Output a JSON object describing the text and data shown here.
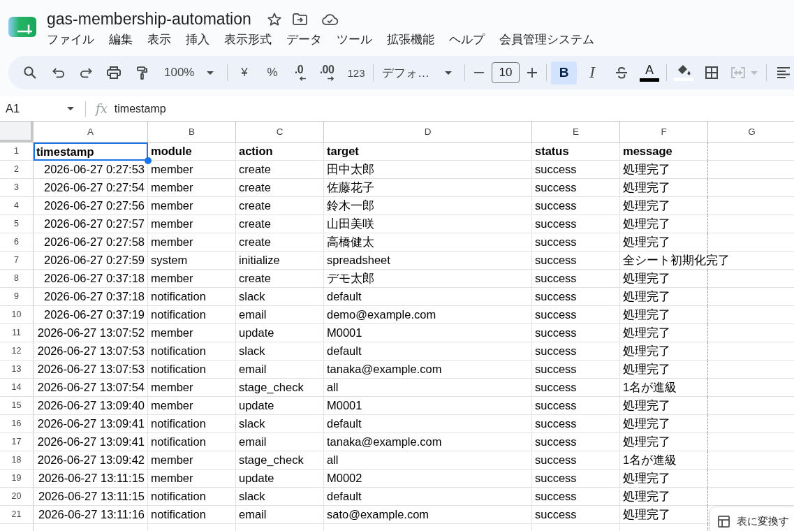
{
  "document": {
    "title": "gas-membership-automation"
  },
  "menu": [
    "ファイル",
    "編集",
    "表示",
    "挿入",
    "表示形式",
    "データ",
    "ツール",
    "拡張機能",
    "ヘルプ",
    "会員管理システム"
  ],
  "toolbar": {
    "zoom": "100%",
    "currency": "¥",
    "percent": "%",
    "decrease_decimals": ".0",
    "increase_decimals": ".00",
    "number_format": "123",
    "font": "デフォ…",
    "font_size": "10",
    "text_styles": [
      {
        "kind": "bold",
        "label": "B",
        "on": true
      },
      {
        "kind": "italic",
        "label": "I",
        "on": false
      },
      {
        "kind": "strikethrough",
        "on": false
      }
    ],
    "text_color": {
      "label": "A"
    },
    "merge": {
      "disabled": true
    }
  },
  "formula_bar": {
    "cell_reference": "A1",
    "function_label": "fx",
    "content": "timestamp"
  },
  "columns": [
    "A",
    "B",
    "C",
    "D",
    "E",
    "F",
    "G"
  ],
  "rows": [
    {
      "number": "1",
      "kind": "header",
      "cells": [
        {
          "text": "timestamp",
          "selected": true
        },
        {
          "text": "module",
          "selected": false
        },
        {
          "text": "action",
          "selected": false
        },
        {
          "text": "target",
          "selected": false
        },
        {
          "text": "status",
          "selected": false
        },
        {
          "text": "message",
          "selected": false
        }
      ]
    },
    {
      "number": "2",
      "kind": "data",
      "cells": [
        {
          "text": "2026-06-27 0:27:53",
          "selected": false
        },
        {
          "text": "member",
          "selected": false
        },
        {
          "text": "create",
          "selected": false
        },
        {
          "text": "田中太郎",
          "selected": false
        },
        {
          "text": "success",
          "selected": false
        },
        {
          "text": "処理完了",
          "selected": false
        }
      ]
    },
    {
      "number": "3",
      "kind": "data",
      "cells": [
        {
          "text": "2026-06-27 0:27:54",
          "selected": false
        },
        {
          "text": "member",
          "selected": false
        },
        {
          "text": "create",
          "selected": false
        },
        {
          "text": "佐藤花子",
          "selected": false
        },
        {
          "text": "success",
          "selected": false
        },
        {
          "text": "処理完了",
          "selected": false
        }
      ]
    },
    {
      "number": "4",
      "kind": "data",
      "cells": [
        {
          "text": "2026-06-27 0:27:56",
          "selected": false
        },
        {
          "text": "member",
          "selected": false
        },
        {
          "text": "create",
          "selected": false
        },
        {
          "text": "鈴木一郎",
          "selected": false
        },
        {
          "text": "success",
          "selected": false
        },
        {
          "text": "処理完了",
          "selected": false
        }
      ]
    },
    {
      "number": "5",
      "kind": "data",
      "cells": [
        {
          "text": "2026-06-27 0:27:57",
          "selected": false
        },
        {
          "text": "member",
          "selected": false
        },
        {
          "text": "create",
          "selected": false
        },
        {
          "text": "山田美咲",
          "selected": false
        },
        {
          "text": "success",
          "selected": false
        },
        {
          "text": "処理完了",
          "selected": false
        }
      ]
    },
    {
      "number": "6",
      "kind": "data",
      "cells": [
        {
          "text": "2026-06-27 0:27:58",
          "selected": false
        },
        {
          "text": "member",
          "selected": false
        },
        {
          "text": "create",
          "selected": false
        },
        {
          "text": "高橋健太",
          "selected": false
        },
        {
          "text": "success",
          "selected": false
        },
        {
          "text": "処理完了",
          "selected": false
        }
      ]
    },
    {
      "number": "7",
      "kind": "data",
      "cells": [
        {
          "text": "2026-06-27 0:27:59",
          "selected": false
        },
        {
          "text": "system",
          "selected": false
        },
        {
          "text": "initialize",
          "selected": false
        },
        {
          "text": "spreadsheet",
          "selected": false
        },
        {
          "text": "success",
          "selected": false
        },
        {
          "text": "全シート初期化完了",
          "selected": false
        }
      ]
    },
    {
      "number": "8",
      "kind": "data",
      "cells": [
        {
          "text": "2026-06-27 0:37:18",
          "selected": false
        },
        {
          "text": "member",
          "selected": false
        },
        {
          "text": "create",
          "selected": false
        },
        {
          "text": "デモ太郎",
          "selected": false
        },
        {
          "text": "success",
          "selected": false
        },
        {
          "text": "処理完了",
          "selected": false
        }
      ]
    },
    {
      "number": "9",
      "kind": "data",
      "cells": [
        {
          "text": "2026-06-27 0:37:18",
          "selected": false
        },
        {
          "text": "notification",
          "selected": false
        },
        {
          "text": "slack",
          "selected": false
        },
        {
          "text": "default",
          "selected": false
        },
        {
          "text": "success",
          "selected": false
        },
        {
          "text": "処理完了",
          "selected": false
        }
      ]
    },
    {
      "number": "10",
      "kind": "data",
      "cells": [
        {
          "text": "2026-06-27 0:37:19",
          "selected": false
        },
        {
          "text": "notification",
          "selected": false
        },
        {
          "text": "email",
          "selected": false
        },
        {
          "text": "demo@example.com",
          "selected": false
        },
        {
          "text": "success",
          "selected": false
        },
        {
          "text": "処理完了",
          "selected": false
        }
      ]
    },
    {
      "number": "11",
      "kind": "data",
      "cells": [
        {
          "text": "2026-06-27 13:07:52",
          "selected": false
        },
        {
          "text": "member",
          "selected": false
        },
        {
          "text": "update",
          "selected": false
        },
        {
          "text": "M0001",
          "selected": false
        },
        {
          "text": "success",
          "selected": false
        },
        {
          "text": "処理完了",
          "selected": false
        }
      ]
    },
    {
      "number": "12",
      "kind": "data",
      "cells": [
        {
          "text": "2026-06-27 13:07:53",
          "selected": false
        },
        {
          "text": "notification",
          "selected": false
        },
        {
          "text": "slack",
          "selected": false
        },
        {
          "text": "default",
          "selected": false
        },
        {
          "text": "success",
          "selected": false
        },
        {
          "text": "処理完了",
          "selected": false
        }
      ]
    },
    {
      "number": "13",
      "kind": "data",
      "cells": [
        {
          "text": "2026-06-27 13:07:53",
          "selected": false
        },
        {
          "text": "notification",
          "selected": false
        },
        {
          "text": "email",
          "selected": false
        },
        {
          "text": "tanaka@example.com",
          "selected": false
        },
        {
          "text": "success",
          "selected": false
        },
        {
          "text": "処理完了",
          "selected": false
        }
      ]
    },
    {
      "number": "14",
      "kind": "data",
      "cells": [
        {
          "text": "2026-06-27 13:07:54",
          "selected": false
        },
        {
          "text": "member",
          "selected": false
        },
        {
          "text": "stage_check",
          "selected": false
        },
        {
          "text": "all",
          "selected": false
        },
        {
          "text": "success",
          "selected": false
        },
        {
          "text": "1名が進級",
          "selected": false
        }
      ]
    },
    {
      "number": "15",
      "kind": "data",
      "cells": [
        {
          "text": "2026-06-27 13:09:40",
          "selected": false
        },
        {
          "text": "member",
          "selected": false
        },
        {
          "text": "update",
          "selected": false
        },
        {
          "text": "M0001",
          "selected": false
        },
        {
          "text": "success",
          "selected": false
        },
        {
          "text": "処理完了",
          "selected": false
        }
      ]
    },
    {
      "number": "16",
      "kind": "data",
      "cells": [
        {
          "text": "2026-06-27 13:09:41",
          "selected": false
        },
        {
          "text": "notification",
          "selected": false
        },
        {
          "text": "slack",
          "selected": false
        },
        {
          "text": "default",
          "selected": false
        },
        {
          "text": "success",
          "selected": false
        },
        {
          "text": "処理完了",
          "selected": false
        }
      ]
    },
    {
      "number": "17",
      "kind": "data",
      "cells": [
        {
          "text": "2026-06-27 13:09:41",
          "selected": false
        },
        {
          "text": "notification",
          "selected": false
        },
        {
          "text": "email",
          "selected": false
        },
        {
          "text": "tanaka@example.com",
          "selected": false
        },
        {
          "text": "success",
          "selected": false
        },
        {
          "text": "処理完了",
          "selected": false
        }
      ]
    },
    {
      "number": "18",
      "kind": "data",
      "cells": [
        {
          "text": "2026-06-27 13:09:42",
          "selected": false
        },
        {
          "text": "member",
          "selected": false
        },
        {
          "text": "stage_check",
          "selected": false
        },
        {
          "text": "all",
          "selected": false
        },
        {
          "text": "success",
          "selected": false
        },
        {
          "text": "1名が進級",
          "selected": false
        }
      ]
    },
    {
      "number": "19",
      "kind": "data",
      "cells": [
        {
          "text": "2026-06-27 13:11:15",
          "selected": false
        },
        {
          "text": "member",
          "selected": false
        },
        {
          "text": "update",
          "selected": false
        },
        {
          "text": "M0002",
          "selected": false
        },
        {
          "text": "success",
          "selected": false
        },
        {
          "text": "処理完了",
          "selected": false
        }
      ]
    },
    {
      "number": "20",
      "kind": "data",
      "cells": [
        {
          "text": "2026-06-27 13:11:15",
          "selected": false
        },
        {
          "text": "notification",
          "selected": false
        },
        {
          "text": "slack",
          "selected": false
        },
        {
          "text": "default",
          "selected": false
        },
        {
          "text": "success",
          "selected": false
        },
        {
          "text": "処理完了",
          "selected": false
        }
      ]
    },
    {
      "number": "21",
      "kind": "data",
      "cells": [
        {
          "text": "2026-06-27 13:11:16",
          "selected": false
        },
        {
          "text": "notification",
          "selected": false
        },
        {
          "text": "email",
          "selected": false
        },
        {
          "text": "sato@example.com",
          "selected": false
        },
        {
          "text": "success",
          "selected": false
        },
        {
          "text": "処理完了",
          "selected": false
        }
      ]
    }
  ],
  "convert_chip": {
    "label": "表に変換す"
  }
}
